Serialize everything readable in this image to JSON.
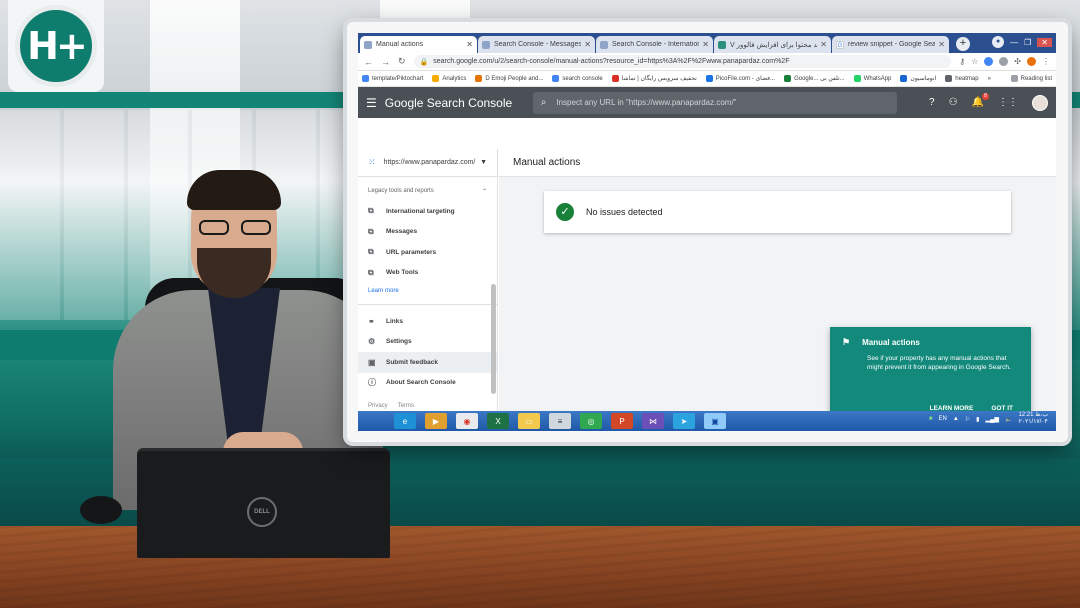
{
  "logo": {
    "text": "H+"
  },
  "browser": {
    "tabs": [
      {
        "title": "Manual actions",
        "active": true
      },
      {
        "title": "Search Console - Messages fo",
        "active": false
      },
      {
        "title": "Search Console - Internationa",
        "active": false
      },
      {
        "title": "V ترفند تولید محتوا برای افزایش فالوور",
        "active": false
      },
      {
        "title": "review snippet - Google Search",
        "active": false
      }
    ],
    "url": "search.google.com/u/2/search-console/manual-actions?resource_id=https%3A%2F%2Fwww.panapardaz.com%2F",
    "bookmarks": [
      {
        "label": "template/Piktochart",
        "color": "#4285f4"
      },
      {
        "label": "Analytics",
        "color": "#f9ab00"
      },
      {
        "label": "D Emoji People and...",
        "color": "#e37400"
      },
      {
        "label": "search console",
        "color": "#4285f4"
      },
      {
        "label": "تخفیف سرویس رایگان | تماشا",
        "color": "#d93025"
      },
      {
        "label": "PicoFile.com - فضای...",
        "color": "#1a73e8"
      },
      {
        "label": "Google... تلفن بی...",
        "color": "#188038"
      },
      {
        "label": "WhatsApp",
        "color": "#25d366"
      },
      {
        "label": "اتوماسیون",
        "color": "#1967d2"
      },
      {
        "label": "heatmap",
        "color": "#5f6368"
      }
    ],
    "reading_list": "Reading list"
  },
  "gsc": {
    "brand": "Google Search Console",
    "search_placeholder": "Inspect any URL in \"https://www.panapardaz.com/\"",
    "notification_count": "8",
    "property": "https://www.panapardaz.com/",
    "sidebar": {
      "section": "Legacy tools and reports",
      "legacy_items": [
        {
          "label": "International targeting",
          "icon": "external-link-icon"
        },
        {
          "label": "Messages",
          "icon": "external-link-icon"
        },
        {
          "label": "URL parameters",
          "icon": "external-link-icon"
        },
        {
          "label": "Web Tools",
          "icon": "external-link-icon"
        }
      ],
      "learn_more": "Learn more",
      "bottom_items": [
        {
          "label": "Links",
          "icon": "links-icon"
        },
        {
          "label": "Settings",
          "icon": "gear-icon"
        },
        {
          "label": "Submit feedback",
          "icon": "feedback-icon"
        },
        {
          "label": "About Search Console",
          "icon": "info-icon"
        }
      ],
      "footer": [
        "Privacy",
        "Terms"
      ]
    },
    "page_title": "Manual actions",
    "status": "No issues detected",
    "toast": {
      "title": "Manual actions",
      "body": "See if your property has any manual actions that might prevent it from appearing in Google Search.",
      "learn_more": "LEARN MORE",
      "got_it": "GOT IT"
    }
  },
  "taskbar": {
    "lang": "EN",
    "time": "12:21",
    "day": "ب.ظ",
    "date": "۲۰۲۱/۱۷/۰۴"
  },
  "laptop_brand": "DELL"
}
